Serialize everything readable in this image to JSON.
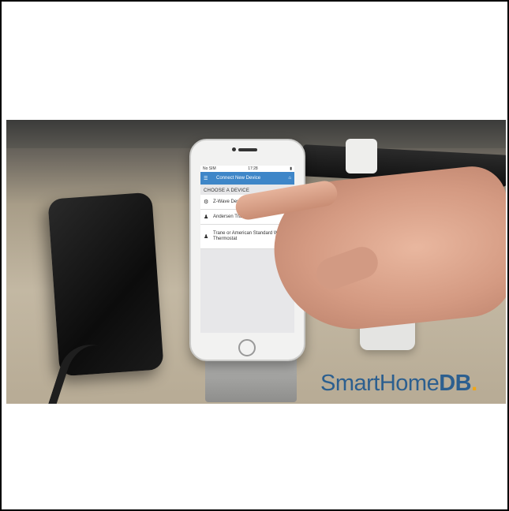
{
  "phone": {
    "status": {
      "carrier": "No SIM",
      "time": "17:28",
      "battery": ""
    },
    "navbar": {
      "title": "Connect New Device"
    },
    "section_header": "CHOOSE A DEVICE",
    "items": [
      {
        "label": "Z-Wave Device",
        "icon": "zwave-icon"
      },
      {
        "label": "Andersen Translator",
        "icon": "person-icon"
      },
      {
        "label": "Trane or American Standard WiFi Thermostat",
        "icon": "people-icon"
      }
    ]
  },
  "watermark": {
    "text": "SmartHome",
    "bold": "DB",
    "dot": "."
  },
  "colors": {
    "nav": "#3e86c8",
    "brand": "#2c5f8f",
    "accent": "#f2a614"
  }
}
